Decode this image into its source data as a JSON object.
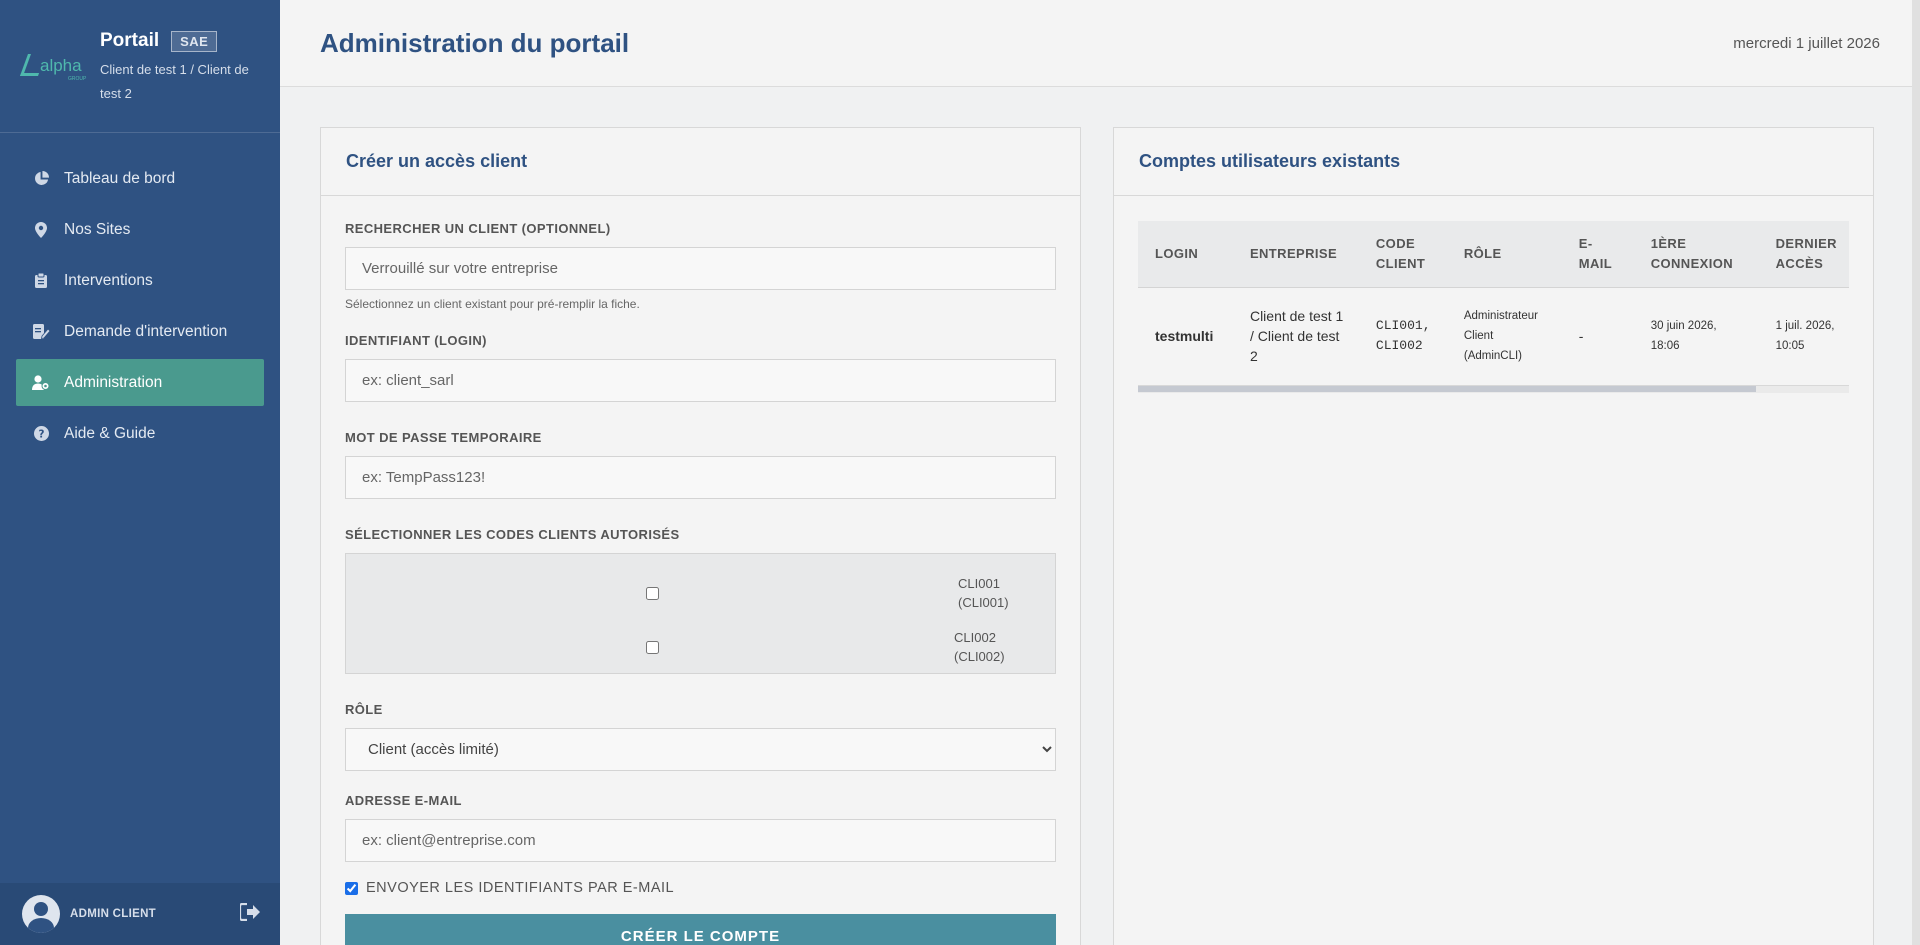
{
  "brand": {
    "logo_text": "alpha",
    "logo_sub": "GROUP",
    "title": "Portail",
    "badge": "SAE",
    "client": "Client de test 1 / Client de test 2"
  },
  "nav": [
    {
      "label": "Tableau de bord",
      "icon": "pie-chart-icon",
      "active": false
    },
    {
      "label": "Nos Sites",
      "icon": "map-pin-icon",
      "active": false
    },
    {
      "label": "Interventions",
      "icon": "clipboard-icon",
      "active": false
    },
    {
      "label": "Demande d'intervention",
      "icon": "edit-document-icon",
      "active": false
    },
    {
      "label": "Administration",
      "icon": "user-gear-icon",
      "active": true
    },
    {
      "label": "Aide & Guide",
      "icon": "question-circle-icon",
      "active": false
    }
  ],
  "user": {
    "name": "ADMIN CLIENT"
  },
  "header": {
    "title": "Administration du portail",
    "date": "mercredi 1 juillet 2026"
  },
  "form": {
    "title": "Créer un accès client",
    "search_label": "Rechercher un client (optionnel)",
    "search_placeholder": "Verrouillé sur votre entreprise",
    "search_hint": "Sélectionnez un client existant pour pré-remplir la fiche.",
    "login_label": "Identifiant (login)",
    "login_placeholder": "ex: client_sarl",
    "password_label": "Mot de passe temporaire",
    "password_placeholder": "ex: TempPass123!",
    "codes_label": "Sélectionner les codes clients autorisés",
    "codes": [
      {
        "code": "CLI001",
        "detail": "(CLI001)",
        "checked": false
      },
      {
        "code": "CLI002",
        "detail": "(CLI002)",
        "checked": false
      }
    ],
    "role_label": "Rôle",
    "role_value": "Client (accès limité)",
    "email_label": "Adresse e-mail",
    "email_placeholder": "ex: client@entreprise.com",
    "send_label": "Envoyer les identifiants par e-mail",
    "send_checked": true,
    "submit_label": "Créer le compte"
  },
  "accounts": {
    "title": "Comptes utilisateurs existants",
    "columns": [
      "Login",
      "Entreprise",
      "Code client",
      "Rôle",
      "E-mail",
      "1ère connexion",
      "Dernier accès"
    ],
    "rows": [
      {
        "login": "testmulti",
        "entreprise": "Client de test 1 / Client de test 2",
        "codes": "CLI001, CLI002",
        "role": "Administrateur Client (AdminCLI)",
        "email": "-",
        "first_login": "30 juin 2026, 18:06",
        "last_access": "1 juil. 2026, 10:05"
      }
    ]
  },
  "colors": {
    "sidebar": "#2f5282",
    "active_nav": "#4a9a8e",
    "title": "#2f5282",
    "button": "#4a8fa0"
  }
}
